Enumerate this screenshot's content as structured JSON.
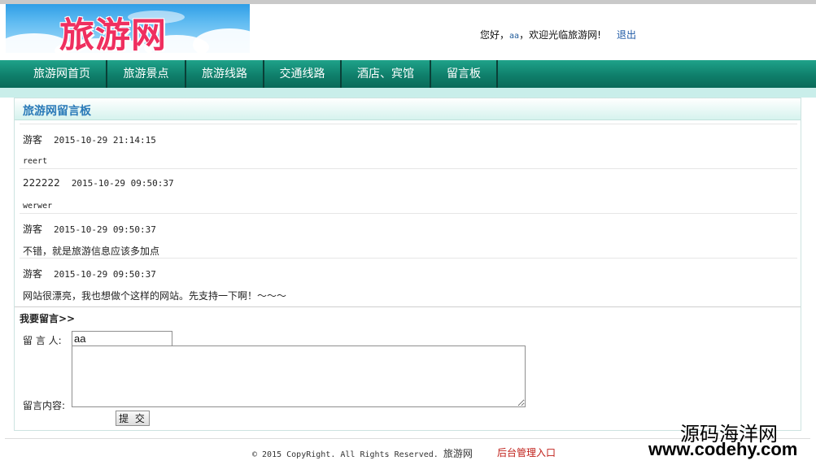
{
  "logo": {
    "text": "旅游网"
  },
  "header": {
    "greeting_prefix": "您好，",
    "username": "aa",
    "greeting_suffix": "，欢迎光临旅游网!",
    "logout_label": "退出"
  },
  "nav": {
    "items": [
      {
        "label": "旅游网首页"
      },
      {
        "label": "旅游景点"
      },
      {
        "label": "旅游线路"
      },
      {
        "label": "交通线路"
      },
      {
        "label": "酒店、宾馆"
      },
      {
        "label": "留言板"
      }
    ]
  },
  "board": {
    "title": "旅游网留言板",
    "messages": [
      {
        "author": "游客",
        "time": "2015-10-29 21:14:15",
        "content": "reert"
      },
      {
        "author": "222222",
        "time": "2015-10-29 09:50:37",
        "content": "werwer"
      },
      {
        "author": "游客",
        "time": "2015-10-29 09:50:37",
        "content": "不错，就是旅游信息应该多加点"
      },
      {
        "author": "游客",
        "time": "2015-10-29 09:50:37",
        "content": "网站很漂亮，我也想做个这样的网站。先支持一下啊！～～～"
      }
    ]
  },
  "form": {
    "title": "我要留言>>",
    "name_label": "留 言 人:",
    "name_value": "aa",
    "content_label": "留言内容:",
    "content_value": "",
    "submit_label": "提 交"
  },
  "footer": {
    "copyright": "© 2015 CopyRight. All Rights Reserved.",
    "site_name": "旅游网",
    "admin_link": "后台管理入口"
  },
  "watermark": {
    "cn": "源码海洋网",
    "url": "www.codehy.com"
  },
  "colors": {
    "nav_green": "#0f7f6b",
    "title_blue": "#2a7ab8",
    "admin_red": "#c0201a",
    "logo_pink": "#ef2f5f"
  }
}
